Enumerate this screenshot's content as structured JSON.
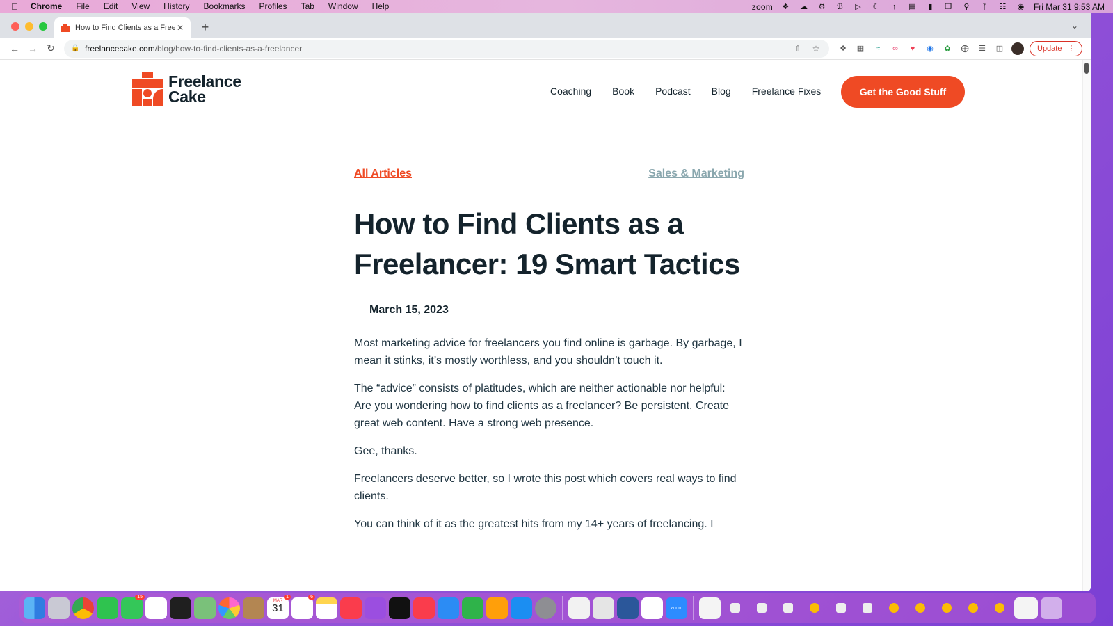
{
  "menubar": {
    "app": "Chrome",
    "items": [
      "File",
      "Edit",
      "View",
      "History",
      "Bookmarks",
      "Profiles",
      "Tab",
      "Window",
      "Help"
    ],
    "zoom_label": "zoom",
    "datetime": "Fri Mar 31  9:53 AM"
  },
  "browser": {
    "tab_title": "How to Find Clients as a Freela",
    "url_host": "freelancecake.com",
    "url_path": "/blog/how-to-find-clients-as-a-freelancer",
    "update_label": "Update"
  },
  "site": {
    "logo_line1": "Freelance",
    "logo_line2": "Cake",
    "nav": [
      "Coaching",
      "Book",
      "Podcast",
      "Blog",
      "Freelance Fixes"
    ],
    "cta": "Get the Good Stuff",
    "accent": "#ef4a24"
  },
  "article": {
    "back_link": "All Articles",
    "category": "Sales & Marketing",
    "title": "How to Find Clients as a Freelancer: 19 Smart Tactics",
    "date": "March 15, 2023",
    "paragraphs": [
      "Most marketing advice for freelancers you find online is garbage. By garbage, I mean it stinks, it’s mostly worthless, and you shouldn’t touch it.",
      "The “advice” consists of platitudes, which are neither actionable nor helpful: Are you wondering how to find clients as a freelancer? Be persistent. Create great web content. Have a strong web presence.",
      "Gee, thanks.",
      "Freelancers deserve better, so I wrote this post which covers real ways to find clients.",
      "You can think of it as the greatest hits from my 14+ years of freelancing. I"
    ]
  },
  "dock": {
    "calendar_month": "MAR",
    "calendar_day": "31",
    "messages_badge": "15",
    "reminders_badge": "6",
    "calendar_badge": "1",
    "zoom_label": "zoom"
  }
}
